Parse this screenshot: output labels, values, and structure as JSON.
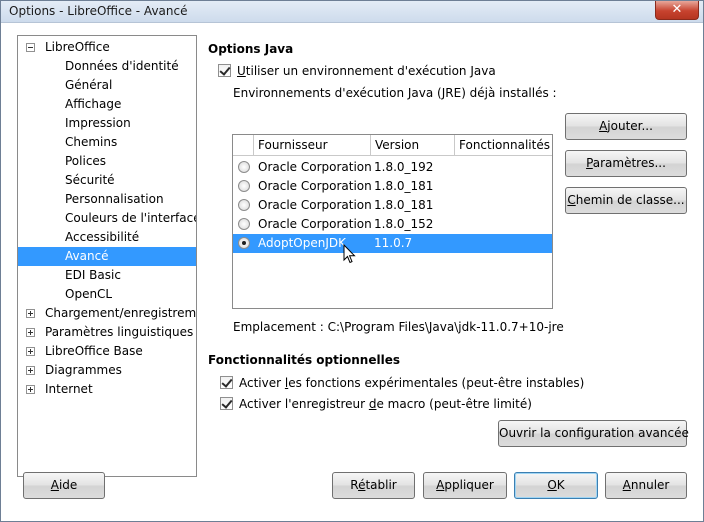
{
  "window": {
    "title": "Options - LibreOffice - Avancé",
    "close_glyph": "✕"
  },
  "tree": {
    "items": [
      {
        "label": "LibreOffice",
        "level": 0,
        "expander": "minus"
      },
      {
        "label": "Données d'identité",
        "level": 1
      },
      {
        "label": "Général",
        "level": 1
      },
      {
        "label": "Affichage",
        "level": 1
      },
      {
        "label": "Impression",
        "level": 1
      },
      {
        "label": "Chemins",
        "level": 1
      },
      {
        "label": "Polices",
        "level": 1
      },
      {
        "label": "Sécurité",
        "level": 1
      },
      {
        "label": "Personnalisation",
        "level": 1
      },
      {
        "label": "Couleurs de l'interface",
        "level": 1
      },
      {
        "label": "Accessibilité",
        "level": 1
      },
      {
        "label": "Avancé",
        "level": 1,
        "selected": true
      },
      {
        "label": "EDI Basic",
        "level": 1
      },
      {
        "label": "OpenCL",
        "level": 1
      },
      {
        "label": "Chargement/enregistrement",
        "level": 0,
        "expander": "plus"
      },
      {
        "label": "Paramètres linguistiques",
        "level": 0,
        "expander": "plus"
      },
      {
        "label": "LibreOffice Base",
        "level": 0,
        "expander": "plus"
      },
      {
        "label": "Diagrammes",
        "level": 0,
        "expander": "plus"
      },
      {
        "label": "Internet",
        "level": 0,
        "expander": "plus"
      }
    ]
  },
  "java": {
    "heading": "Options Java",
    "use_jre_label_ul": "U",
    "use_jre_label_rest": "tiliser un environnement d'exécution Java",
    "use_jre_checked": true,
    "installed_label": "Environnements d'exécution Java (JRE) déjà installés :",
    "columns": [
      "Fournisseur",
      "Version",
      "Fonctionnalités"
    ],
    "rows": [
      {
        "vendor": "Oracle Corporation",
        "version": "1.8.0_192",
        "selected": false
      },
      {
        "vendor": "Oracle Corporation",
        "version": "1.8.0_181",
        "selected": false
      },
      {
        "vendor": "Oracle Corporation",
        "version": "1.8.0_181",
        "selected": false
      },
      {
        "vendor": "Oracle Corporation",
        "version": "1.8.0_152",
        "selected": false
      },
      {
        "vendor": "AdoptOpenJDK",
        "version": "11.0.7",
        "selected": true
      }
    ],
    "buttons": {
      "add_ul": "A",
      "add_rest": "jouter...",
      "params_ul": "P",
      "params_rest": "aramètres...",
      "classpath_ul": "C",
      "classpath_rest": "hemin de classe..."
    },
    "location_label": "Emplacement : C:\\Program Files\\Java\\jdk-11.0.7+10-jre"
  },
  "optional": {
    "heading": "Fonctionnalités optionnelles",
    "experimental_pre": "Activer ",
    "experimental_ul": "l",
    "experimental_post": "es fonctions expérimentales (peut-être instables)",
    "experimental_checked": true,
    "macro_pre": "Activer l'enregistreur ",
    "macro_ul": "d",
    "macro_post": "e macro (peut-être limité)",
    "macro_checked": true,
    "expert_button": "Ouvrir la configuration avancée"
  },
  "footer": {
    "help_ul": "A",
    "help_rest": "ide",
    "reset_pre": "R",
    "reset_ul": "é",
    "reset_rest": "tablir",
    "apply_ul": "A",
    "apply_rest": "ppliquer",
    "ok_ul": "O",
    "ok_rest": "K",
    "cancel_ul": "A",
    "cancel_rest": "nnuler"
  }
}
